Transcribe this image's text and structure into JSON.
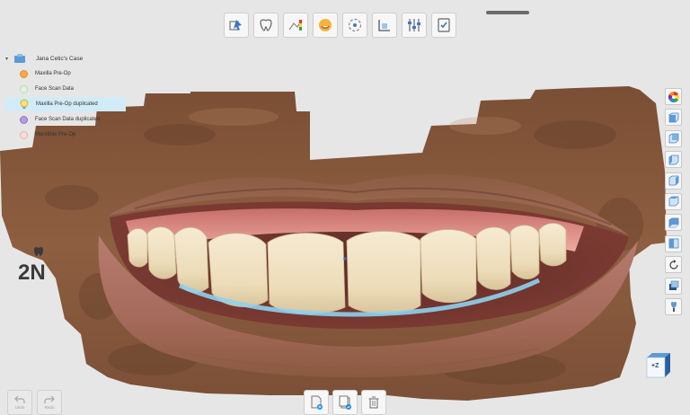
{
  "case": {
    "title": "Jana Cetic's Case",
    "items": [
      {
        "label": "Maxilla Pre-Op",
        "color": "#f4a94d",
        "selected": false
      },
      {
        "label": "Face Scan Data",
        "color": "#cfe9cf",
        "selected": false
      },
      {
        "label": "Maxilla Pre-Op duplicated",
        "color": "#f6e27a",
        "selected": true
      },
      {
        "label": "Face Scan Data duplicated",
        "color": "#b39ddb",
        "selected": false
      },
      {
        "label": "Mandible Pre-Op",
        "color": "#f4d2cc",
        "selected": false
      }
    ]
  },
  "toolbar": {
    "icons": [
      "select-tool-icon",
      "tooth-outline-icon",
      "color-map-icon",
      "smile-design-icon",
      "rotate-view-icon",
      "occlusal-plane-icon",
      "adjust-sliders-icon",
      "checklist-icon"
    ]
  },
  "side_toolbar": {
    "icons": [
      "color-wheel-icon",
      "view-cube-front-icon",
      "view-cube-back-icon",
      "view-cube-left-icon",
      "view-cube-right-icon",
      "view-cube-top-icon",
      "view-cube-bottom-icon",
      "split-view-icon",
      "reset-rotation-icon",
      "layers-icon",
      "tooth-pin-icon"
    ]
  },
  "brand": {
    "text": "2N"
  },
  "orientation": {
    "label": "+Z"
  },
  "history": {
    "undo_label": "Undo",
    "redo_label": "Redo"
  },
  "bottom_actions": {
    "icons": [
      "add-file-icon",
      "copy-file-icon",
      "delete-icon"
    ]
  },
  "colors": {
    "skin": "#8a5a3c",
    "lip": "#b4766a",
    "tooth": "#efe1c2",
    "gum": "#e48f87",
    "margin": "#8fd0ee",
    "accent": "#1e88e5"
  }
}
